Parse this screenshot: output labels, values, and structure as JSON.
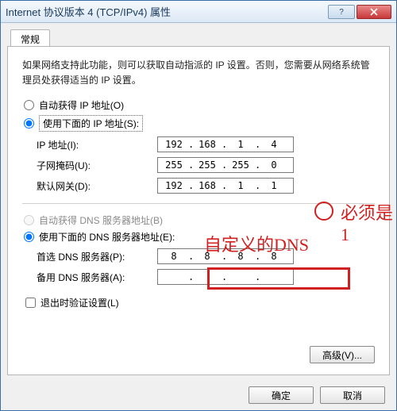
{
  "window": {
    "title": "Internet 协议版本 4 (TCP/IPv4) 属性"
  },
  "tab": {
    "label": "常规"
  },
  "description": "如果网络支持此功能，则可以获取自动指派的 IP 设置。否则，您需要从网络系统管理员处获得适当的 IP 设置。",
  "ip_section": {
    "auto_label": "自动获得 IP 地址(O)",
    "manual_label": "使用下面的 IP 地址(S):",
    "fields": {
      "ip_label": "IP 地址(I):",
      "ip": [
        "192",
        "168",
        "1",
        "4"
      ],
      "mask_label": "子网掩码(U):",
      "mask": [
        "255",
        "255",
        "255",
        "0"
      ],
      "gateway_label": "默认网关(D):",
      "gateway": [
        "192",
        "168",
        "1",
        "1"
      ]
    }
  },
  "dns_section": {
    "auto_label": "自动获得 DNS 服务器地址(B)",
    "manual_label": "使用下面的 DNS 服务器地址(E):",
    "fields": {
      "pref_label": "首选 DNS 服务器(P):",
      "pref": [
        "8",
        "8",
        "8",
        "8"
      ],
      "alt_label": "备用 DNS 服务器(A):",
      "alt": [
        "",
        "",
        "",
        ""
      ]
    }
  },
  "validate_label": "退出时验证设置(L)",
  "advanced_label": "高级(V)...",
  "ok_label": "确定",
  "cancel_label": "取消",
  "annotations": {
    "must_be_1": "必须是1",
    "custom_dns": "自定义的DNS"
  }
}
